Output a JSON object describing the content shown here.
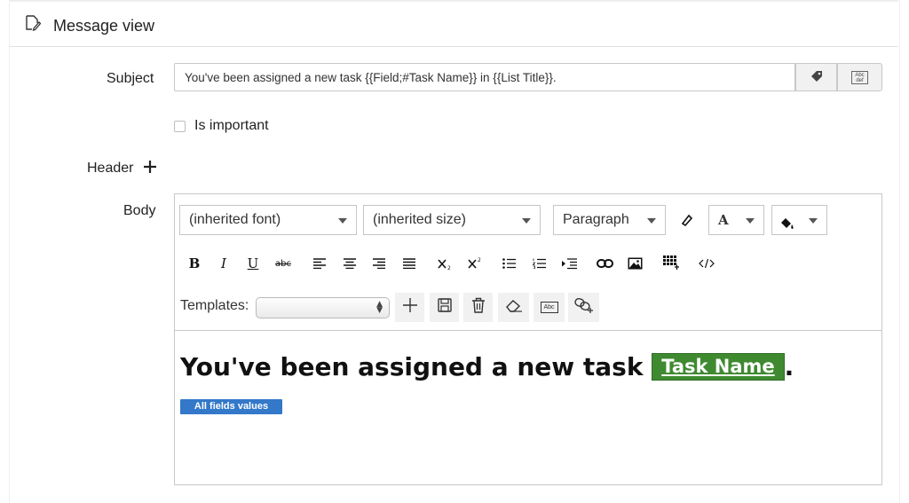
{
  "header": {
    "title": "Message view",
    "icon": "note-edit-icon"
  },
  "subject": {
    "label": "Subject",
    "value": "You've been assigned a new task {{Field;#Task Name}} in {{List Title}}.",
    "buttons": [
      "tag-icon",
      "text-field-icon"
    ],
    "text_field_icon_text": "Abc def"
  },
  "important": {
    "label": "Is important",
    "checked": false
  },
  "header_section": {
    "label": "Header",
    "add_icon": "plus-icon"
  },
  "body": {
    "label": "Body",
    "toolbar": {
      "font": "(inherited font)",
      "size": "(inherited size)",
      "format": "Paragraph",
      "bold": "B",
      "italic": "I",
      "underline": "U",
      "strike": "abc",
      "font_color": "A",
      "abc_icon_text": "Abc",
      "buttons_row2": [
        "bold",
        "italic",
        "underline",
        "strikethrough",
        "align-left",
        "align-center",
        "align-right",
        "justify",
        "subscript",
        "superscript",
        "bullet-list",
        "numbered-list",
        "indent",
        "link",
        "image",
        "table",
        "source-code"
      ]
    },
    "templates": {
      "label": "Templates:",
      "selected": "",
      "buttons": [
        "add-icon",
        "save-icon",
        "delete-icon",
        "eraser-icon",
        "text-field-icon",
        "link-add-icon"
      ]
    },
    "content": {
      "heading_prefix": "You've been assigned a new task",
      "field_tag": "Task Name",
      "heading_suffix": ".",
      "badge": "All fields values"
    }
  },
  "colors": {
    "field_tag": "#3f8a31",
    "badge": "#3378c9"
  }
}
